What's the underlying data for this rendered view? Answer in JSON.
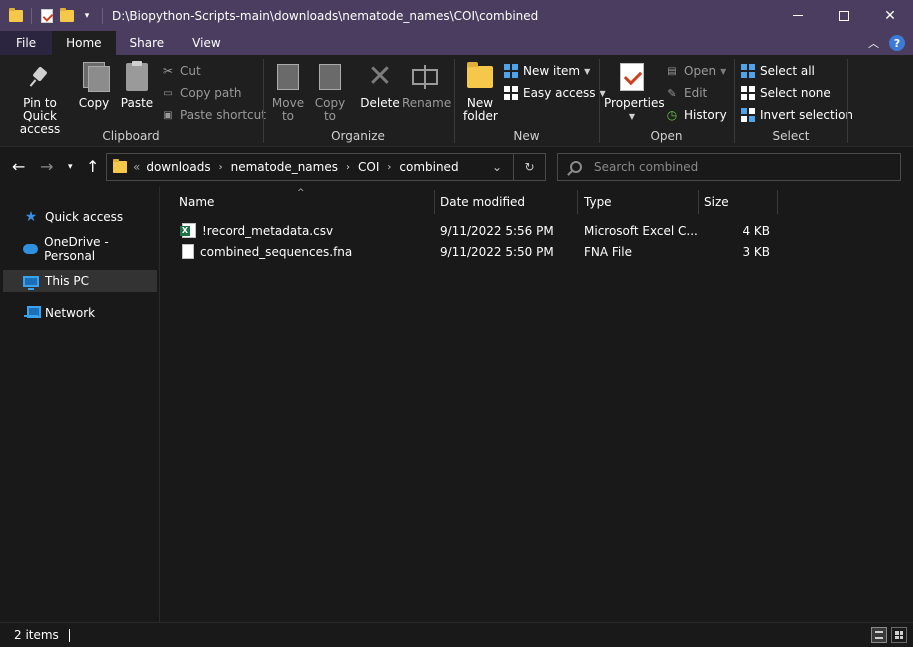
{
  "window": {
    "title": "D:\\Biopython-Scripts-main\\downloads\\nematode_names\\COI\\combined",
    "minimize": "—",
    "maximize": "",
    "close": "✕"
  },
  "tabs": [
    {
      "label": "File"
    },
    {
      "label": "Home"
    },
    {
      "label": "Share"
    },
    {
      "label": "View"
    }
  ],
  "ribbon": {
    "clipboard": {
      "label": "Clipboard",
      "pin": "Pin to Quick access",
      "copy": "Copy",
      "paste": "Paste",
      "cut": "Cut",
      "copy_path": "Copy path",
      "paste_shortcut": "Paste shortcut"
    },
    "organize": {
      "label": "Organize",
      "move_to": "Move to",
      "copy_to": "Copy to",
      "delete": "Delete",
      "rename": "Rename"
    },
    "new": {
      "label": "New",
      "new_folder": "New folder",
      "new_item": "New item",
      "easy_access": "Easy access"
    },
    "open": {
      "label": "Open",
      "properties": "Properties",
      "open": "Open",
      "edit": "Edit",
      "history": "History"
    },
    "select": {
      "label": "Select",
      "select_all": "Select all",
      "select_none": "Select none",
      "invert_selection": "Invert selection"
    }
  },
  "address": {
    "lead": "«",
    "crumbs": [
      "downloads",
      "nematode_names",
      "COI",
      "combined"
    ]
  },
  "search": {
    "placeholder": "Search combined"
  },
  "sidebar": {
    "items": [
      {
        "label": "Quick access",
        "icon": "star-icon"
      },
      {
        "label": "OneDrive - Personal",
        "icon": "cloud-icon"
      },
      {
        "label": "This PC",
        "icon": "computer-icon",
        "selected": true
      },
      {
        "label": "Network",
        "icon": "network-icon"
      }
    ]
  },
  "table": {
    "columns": [
      "Name",
      "Date modified",
      "Type",
      "Size"
    ],
    "rows": [
      {
        "name": "!record_metadata.csv",
        "date": "9/11/2022 5:56 PM",
        "type": "Microsoft Excel C...",
        "size": "4 KB",
        "icon": "excel-file-icon"
      },
      {
        "name": "combined_sequences.fna",
        "date": "9/11/2022 5:50 PM",
        "type": "FNA File",
        "size": "3 KB",
        "icon": "file-icon"
      }
    ]
  },
  "status": {
    "item_count": "2 items"
  }
}
